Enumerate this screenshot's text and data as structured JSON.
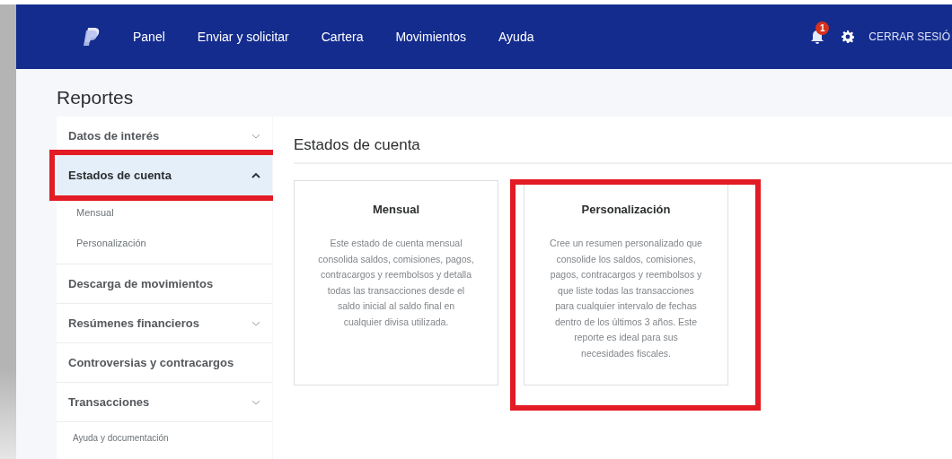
{
  "nav": {
    "links": [
      {
        "label": "Panel"
      },
      {
        "label": "Enviar y solicitar"
      },
      {
        "label": "Cartera"
      },
      {
        "label": "Movimientos"
      },
      {
        "label": "Ayuda"
      }
    ],
    "notifications": {
      "badge": "1"
    },
    "logout": "CERRAR SESIÓ"
  },
  "page_title": "Reportes",
  "sidebar": {
    "items": [
      {
        "label": "Datos de interés",
        "kind": "group",
        "expanded": false,
        "selected": false,
        "highlighted": false
      },
      {
        "label": "Estados de cuenta",
        "kind": "group",
        "expanded": true,
        "selected": true,
        "highlighted": true,
        "children": [
          {
            "label": "Mensual"
          },
          {
            "label": "Personalización"
          }
        ]
      },
      {
        "label": "Descarga de movimientos",
        "kind": "link",
        "selected": false,
        "highlighted": false
      },
      {
        "label": "Resúmenes financieros",
        "kind": "group",
        "expanded": false,
        "selected": false,
        "highlighted": false
      },
      {
        "label": "Controversias y contracargos",
        "kind": "link",
        "selected": false,
        "highlighted": false
      },
      {
        "label": "Transacciones",
        "kind": "group",
        "expanded": false,
        "selected": false,
        "highlighted": false
      },
      {
        "label": "Ayuda y documentación",
        "kind": "footer"
      }
    ]
  },
  "main": {
    "heading": "Estados de cuenta",
    "cards": [
      {
        "title": "Mensual",
        "text": "Este estado de cuenta mensual consolida saldos, comisiones, pagos, contracargos y reembolsos y detalla todas las transacciones desde el saldo inicial al saldo final en cualquier divisa utilizada.",
        "highlighted": false
      },
      {
        "title": "Personalización",
        "text": "Cree un resumen personalizado que consolide los saldos, comisiones, pagos, contracargos y reembolsos y que liste todas las transacciones para cualquier intervalo de fechas dentro de los últimos 3 años. Este reporte es ideal para sus necesidades fiscales.",
        "highlighted": true
      }
    ]
  }
}
